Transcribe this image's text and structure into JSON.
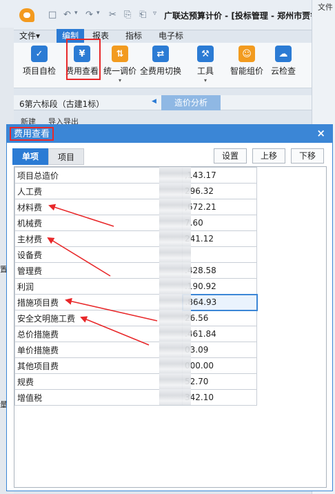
{
  "app": {
    "title": "广联达预算计价 - [投标管理 - 郑州市贾鲁河综",
    "quick_access": [
      "□",
      "↶",
      "▾",
      "↷",
      "▾",
      "✂",
      "⎘",
      "⎗",
      "▿"
    ],
    "right_sliver_label": "文件"
  },
  "menu": {
    "items": [
      {
        "label": "文件▾",
        "active": false
      },
      {
        "label": "编制",
        "active": true
      },
      {
        "label": "报表",
        "active": false
      },
      {
        "label": "指标",
        "active": false
      },
      {
        "label": "电子标",
        "active": false
      }
    ]
  },
  "ribbon": {
    "buttons": [
      {
        "label": "项目自检",
        "icon": "project-check-icon",
        "glyph": "✓",
        "color": "#2b7bd4"
      },
      {
        "label": "费用查看",
        "icon": "cost-view-icon",
        "glyph": "¥",
        "color": "#2b7bd4"
      },
      {
        "label": "统一调价",
        "icon": "price-adjust-icon",
        "glyph": "⇅",
        "color": "#f29b1f"
      },
      {
        "label": "全费用切换",
        "icon": "full-cost-switch-icon",
        "glyph": "⇄",
        "color": "#2b7bd4"
      },
      {
        "label": "工具",
        "icon": "tools-icon",
        "glyph": "⚒",
        "color": "#2b7bd4"
      },
      {
        "label": "智能组价",
        "icon": "smart-pricing-icon",
        "glyph": "☺",
        "color": "#f29b1f"
      },
      {
        "label": "云检查",
        "icon": "cloud-check-icon",
        "glyph": "☁",
        "color": "#2b7bd4"
      }
    ]
  },
  "project_bar": {
    "name": "6第六标段（古建1标）",
    "tab": "造价分析",
    "behind_cols": [
      "新建",
      "导入导出"
    ]
  },
  "left_hints": [
    "置",
    "量"
  ],
  "dialog": {
    "title": "费用查看",
    "close": "×",
    "tabs": [
      {
        "label": "单项",
        "active": true
      },
      {
        "label": "项目",
        "active": false
      }
    ],
    "buttons": {
      "settings": "设置",
      "move_up": "上移",
      "move_down": "下移"
    },
    "rows": [
      {
        "name": "项目总造价",
        "value": ",143.17"
      },
      {
        "name": "人工费",
        "value": "296.32"
      },
      {
        "name": "材料费",
        "value": ",672.21"
      },
      {
        "name": "机械费",
        "value": "7.60"
      },
      {
        "name": "主材费",
        "value": "241.12"
      },
      {
        "name": "设备费",
        "value": ""
      },
      {
        "name": "管理费",
        "value": ".428.58"
      },
      {
        "name": "利润",
        "value": ".190.92"
      },
      {
        "name": "措施项目费",
        "value": ".864.93"
      },
      {
        "name": "安全文明施工费",
        "value": "26.56"
      },
      {
        "name": "总价措施费",
        "value": ".461.84"
      },
      {
        "name": "单价措施费",
        "value": "03.09"
      },
      {
        "name": "其他项目费",
        "value": "000.00"
      },
      {
        "name": "规费",
        "value": "52.70"
      },
      {
        "name": "增值税",
        "value": "342.10"
      }
    ],
    "selected_row": 8,
    "annotation_color": "#e8282a"
  }
}
